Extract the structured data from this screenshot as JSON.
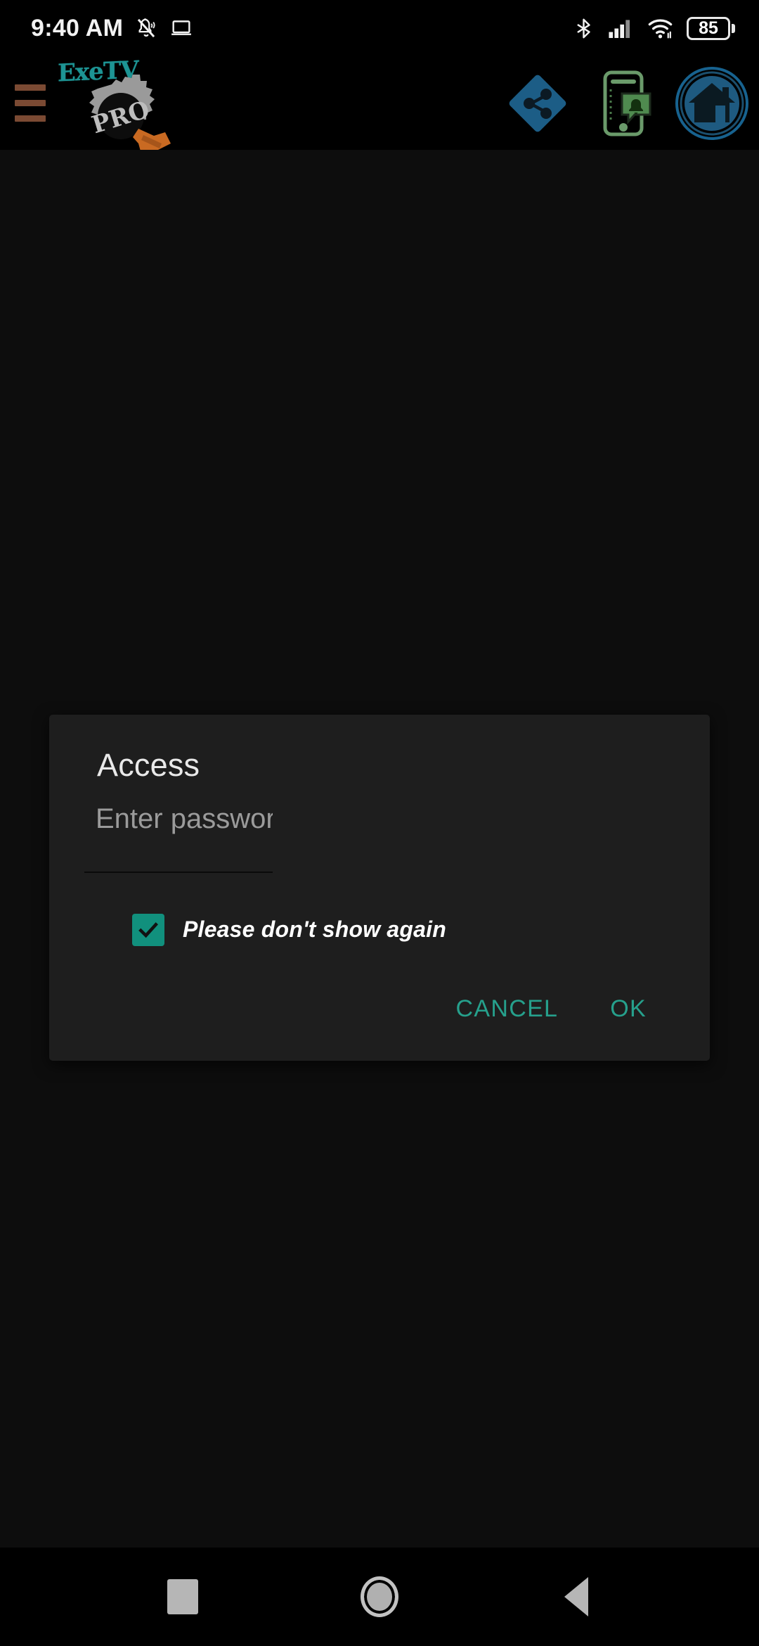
{
  "status_bar": {
    "time": "9:40 AM",
    "icons": [
      {
        "name": "notifications-muted-icon"
      },
      {
        "name": "cast-laptop-icon"
      },
      {
        "name": "bluetooth-icon"
      },
      {
        "name": "cellular-signal-icon"
      },
      {
        "name": "wifi-icon"
      }
    ],
    "battery_percent": "85"
  },
  "header": {
    "menu_icon": "hamburger-menu-icon",
    "brand_name": "ExeTV",
    "brand_badge": "PRO",
    "actions": [
      {
        "name": "share-icon",
        "label": "Share"
      },
      {
        "name": "phone-notification-icon",
        "label": "Notifications"
      },
      {
        "name": "home-icon",
        "label": "Home"
      }
    ]
  },
  "dialog": {
    "title": "Access",
    "password_placeholder": "Enter password",
    "password_value": "",
    "checkbox": {
      "label": "Please don't show again",
      "checked": true,
      "icon": "checkmark-icon"
    },
    "cancel_label": "CANCEL",
    "ok_label": "OK"
  },
  "nav_bar": {
    "recents": "recents-square-icon",
    "home": "home-circle-icon",
    "back": "back-triangle-icon"
  },
  "colors": {
    "background": "#0d0d0d",
    "dialog_background": "#1e1e1e",
    "accent_teal": "#26a08c",
    "checkbox_teal": "#11907d",
    "brand_teal": "#1d9494",
    "menu_brown": "#7b4a33",
    "share_blue": "#1c5d86",
    "notify_green": "#4a7a4a"
  }
}
